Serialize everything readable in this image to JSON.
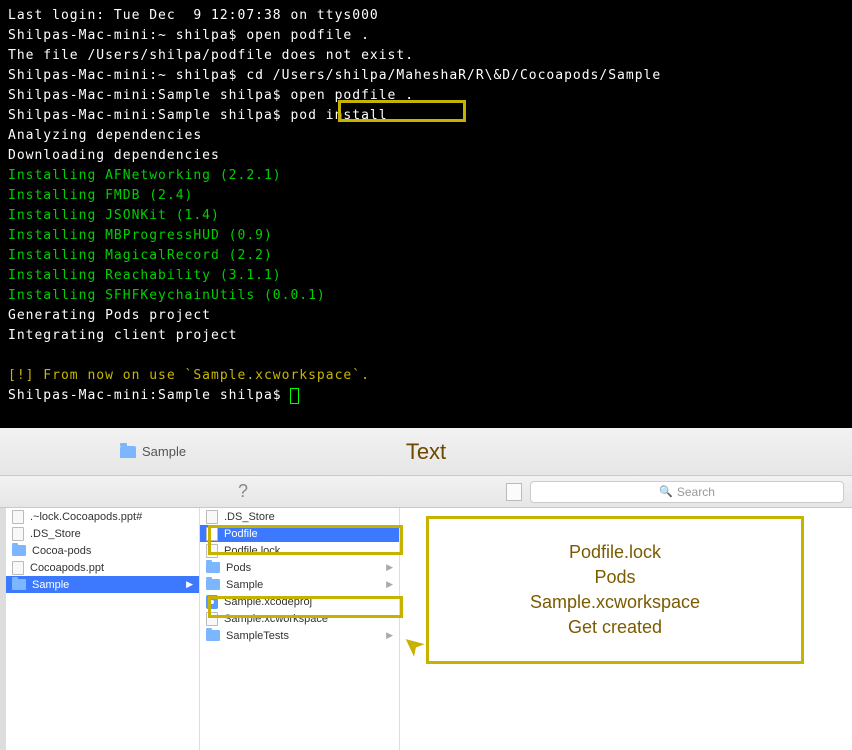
{
  "terminal": {
    "line1": "Last login: Tue Dec  9 12:07:38 on ttys000",
    "line2": "Shilpas-Mac-mini:~ shilpa$ open podfile .",
    "line3": "The file /Users/shilpa/podfile does not exist.",
    "line4": "Shilpas-Mac-mini:~ shilpa$ cd /Users/shilpa/MaheshaR/R\\&D/Cocoapods/Sample",
    "line5": "Shilpas-Mac-mini:Sample shilpa$ open podfile .",
    "line6_a": "Shilpas-Mac-mini:Sample shilpa$ ",
    "line6_b": "pod install",
    "line7": "Analyzing dependencies",
    "line8": "Downloading dependencies",
    "i1": "Installing AFNetworking (2.2.1)",
    "i2": "Installing FMDB (2.4)",
    "i3": "Installing JSONKit (1.4)",
    "i4": "Installing MBProgressHUD (0.9)",
    "i5": "Installing MagicalRecord (2.2)",
    "i6": "Installing Reachability (3.1.1)",
    "i7": "Installing SFHFKeychainUtils (0.0.1)",
    "g1": "Generating Pods project",
    "g2": "Integrating client project",
    "warn": "[!] From now on use `Sample.xcworkspace`.",
    "prompt": "Shilpas-Mac-mini:Sample shilpa$ "
  },
  "header": {
    "folder": "Sample",
    "title": "Text"
  },
  "toolbar": {
    "search_ph": "Search"
  },
  "col1": {
    "a": ".~lock.Cocoapods.ppt#",
    "b": ".DS_Store",
    "c": "Cocoa-pods",
    "d": "Cocoapods.ppt",
    "e": "Sample"
  },
  "col2": {
    "a": ".DS_Store",
    "b": "Podfile",
    "c": "Podfile.lock",
    "d": "Pods",
    "e": "Sample",
    "f": "Sample.xcodeproj",
    "g": "Sample.xcworkspace",
    "h": "SampleTests"
  },
  "callout": {
    "l1": "Podfile.lock",
    "l2": "Pods",
    "l3": "Sample.xcworkspace",
    "l4": "Get created"
  }
}
